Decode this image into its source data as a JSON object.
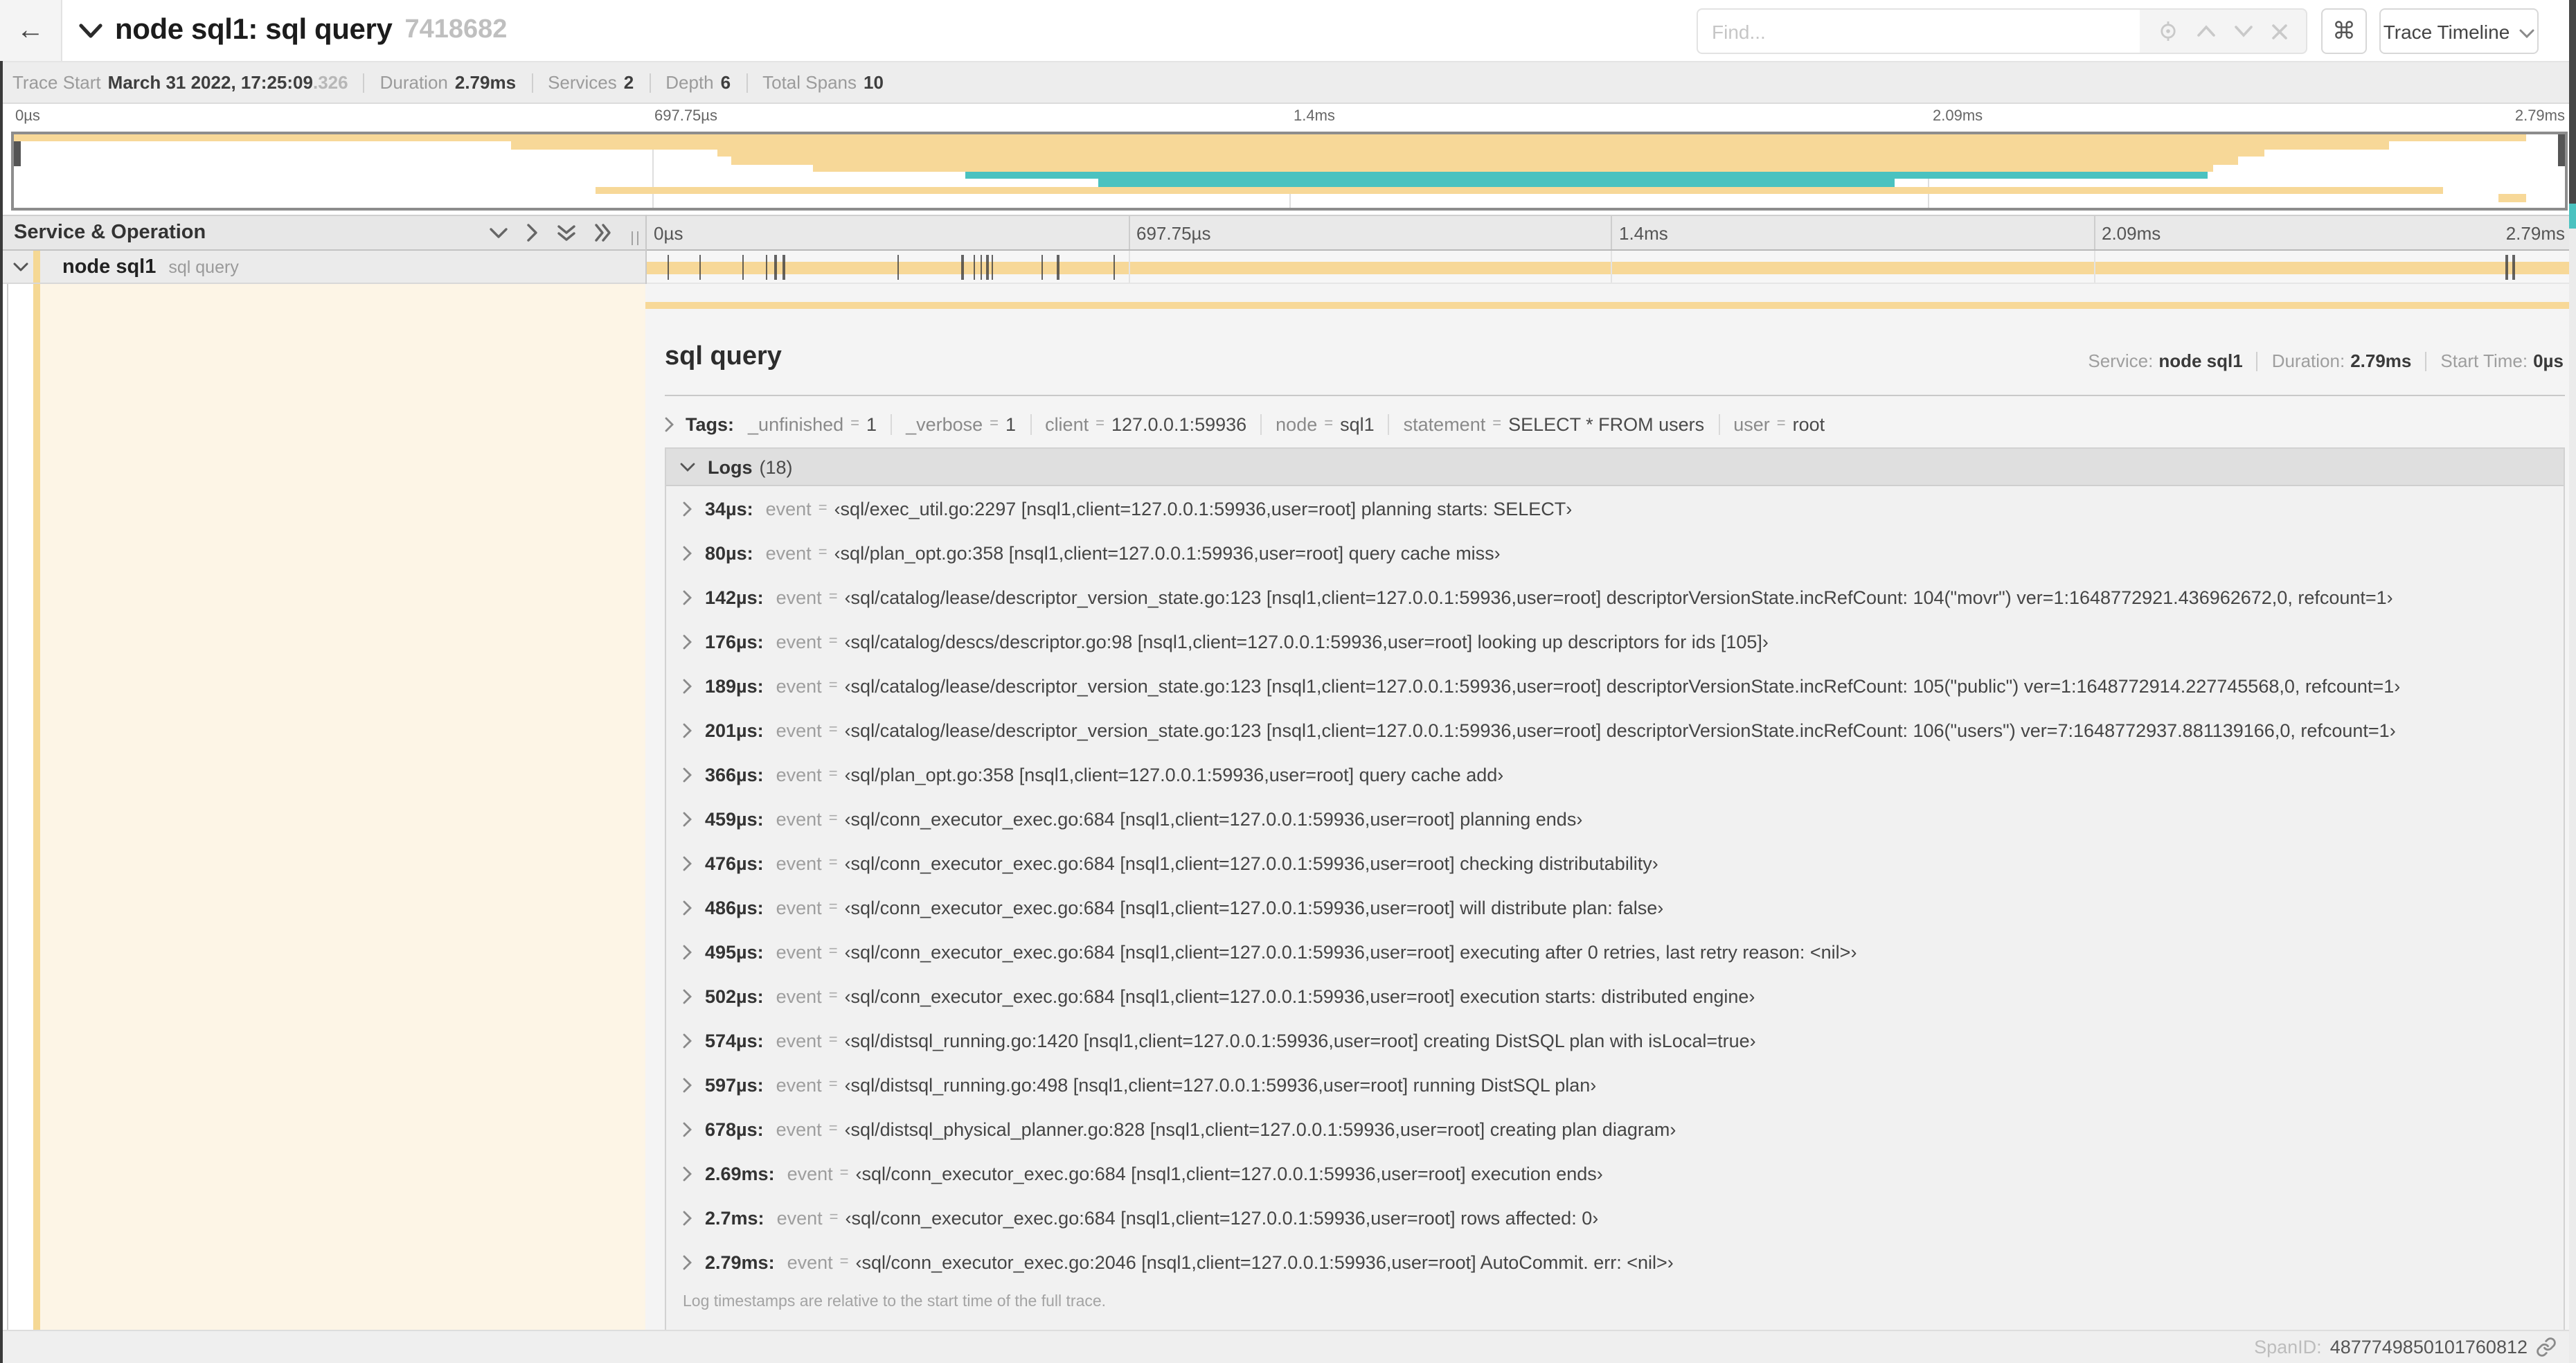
{
  "header": {
    "title": "node sql1: sql query",
    "trace_id": "7418682",
    "find_placeholder": "Find...",
    "view_select": "Trace Timeline"
  },
  "icons": {
    "back": "←",
    "command": "⌘"
  },
  "trace_info": {
    "items": [
      {
        "label": "Trace Start",
        "value": "March 31 2022, 17:25:09",
        "muted": ".326"
      },
      {
        "label": "Duration",
        "value": "2.79ms"
      },
      {
        "label": "Services",
        "value": "2"
      },
      {
        "label": "Depth",
        "value": "6"
      },
      {
        "label": "Total Spans",
        "value": "10"
      }
    ]
  },
  "colors": {
    "tan": "#f7d898",
    "teal": "#4ac2c0",
    "cream": "#fdf5e6",
    "strip": "#f5d894"
  },
  "minimap": {
    "ticks": [
      "0µs",
      "697.75µs",
      "1.4ms",
      "2.09ms",
      "2.79ms"
    ],
    "spans": [
      {
        "row": 0,
        "start": 0,
        "end": 98.5,
        "color": "tan"
      },
      {
        "row": 1,
        "start": 19.5,
        "end": 93.1,
        "color": "tan"
      },
      {
        "row": 2,
        "start": 27.6,
        "end": 88.2,
        "color": "tan"
      },
      {
        "row": 3,
        "start": 28.1,
        "end": 87.2,
        "color": "tan"
      },
      {
        "row": 4,
        "start": 31.3,
        "end": 86.2,
        "color": "tan"
      },
      {
        "row": 5,
        "start": 37.3,
        "end": 86.0,
        "color": "teal"
      },
      {
        "row": 6,
        "start": 42.5,
        "end": 73.7,
        "color": "teal"
      },
      {
        "row": 7,
        "start": 22.8,
        "end": 95.2,
        "color": "tan"
      },
      {
        "row": 8,
        "start": 97.4,
        "end": 98.5,
        "color": "tan"
      }
    ]
  },
  "timeline": {
    "header_title": "Service & Operation",
    "ruler_ticks": [
      "0µs",
      "697.75µs",
      "1.4ms",
      "2.09ms",
      "2.79ms"
    ],
    "row": {
      "service": "node sql1",
      "operation": "sql query",
      "total_us": 2790,
      "event_times_us": [
        34,
        80,
        142,
        176,
        189,
        201,
        366,
        459,
        476,
        486,
        495,
        502,
        574,
        597,
        678,
        2690,
        2700,
        2790
      ]
    }
  },
  "detail": {
    "operation": "sql query",
    "meta": [
      {
        "label": "Service:",
        "value": "node sql1"
      },
      {
        "label": "Duration:",
        "value": "2.79ms"
      },
      {
        "label": "Start Time:",
        "value": "0µs"
      }
    ],
    "tags": {
      "label": "Tags:",
      "separator": "=",
      "items": [
        {
          "key": "_unfinished",
          "value": "1"
        },
        {
          "key": "_verbose",
          "value": "1"
        },
        {
          "key": "client",
          "value": "127.0.0.1:59936"
        },
        {
          "key": "node",
          "value": "sql1"
        },
        {
          "key": "statement",
          "value": "SELECT * FROM users"
        },
        {
          "key": "user",
          "value": "root"
        }
      ]
    },
    "logs": {
      "label": "Logs",
      "count": "(18)",
      "field": "event",
      "separator": "=",
      "entries": [
        {
          "time": "34µs:",
          "value": "‹sql/exec_util.go:2297 [nsql1,client=127.0.0.1:59936,user=root] planning starts: SELECT›"
        },
        {
          "time": "80µs:",
          "value": "‹sql/plan_opt.go:358 [nsql1,client=127.0.0.1:59936,user=root] query cache miss›"
        },
        {
          "time": "142µs:",
          "value": "‹sql/catalog/lease/descriptor_version_state.go:123 [nsql1,client=127.0.0.1:59936,user=root] descriptorVersionState.incRefCount: 104(\"movr\") ver=1:1648772921.436962672,0, refcount=1›"
        },
        {
          "time": "176µs:",
          "value": "‹sql/catalog/descs/descriptor.go:98 [nsql1,client=127.0.0.1:59936,user=root] looking up descriptors for ids [105]›"
        },
        {
          "time": "189µs:",
          "value": "‹sql/catalog/lease/descriptor_version_state.go:123 [nsql1,client=127.0.0.1:59936,user=root] descriptorVersionState.incRefCount: 105(\"public\") ver=1:1648772914.227745568,0, refcount=1›"
        },
        {
          "time": "201µs:",
          "value": "‹sql/catalog/lease/descriptor_version_state.go:123 [nsql1,client=127.0.0.1:59936,user=root] descriptorVersionState.incRefCount: 106(\"users\") ver=7:1648772937.881139166,0, refcount=1›"
        },
        {
          "time": "366µs:",
          "value": "‹sql/plan_opt.go:358 [nsql1,client=127.0.0.1:59936,user=root] query cache add›"
        },
        {
          "time": "459µs:",
          "value": "‹sql/conn_executor_exec.go:684 [nsql1,client=127.0.0.1:59936,user=root] planning ends›"
        },
        {
          "time": "476µs:",
          "value": "‹sql/conn_executor_exec.go:684 [nsql1,client=127.0.0.1:59936,user=root] checking distributability›"
        },
        {
          "time": "486µs:",
          "value": "‹sql/conn_executor_exec.go:684 [nsql1,client=127.0.0.1:59936,user=root] will distribute plan: false›"
        },
        {
          "time": "495µs:",
          "value": "‹sql/conn_executor_exec.go:684 [nsql1,client=127.0.0.1:59936,user=root] executing after 0 retries, last retry reason: <nil>›"
        },
        {
          "time": "502µs:",
          "value": "‹sql/conn_executor_exec.go:684 [nsql1,client=127.0.0.1:59936,user=root] execution starts: distributed engine›"
        },
        {
          "time": "574µs:",
          "value": "‹sql/distsql_running.go:1420 [nsql1,client=127.0.0.1:59936,user=root] creating DistSQL plan with isLocal=true›"
        },
        {
          "time": "597µs:",
          "value": "‹sql/distsql_running.go:498 [nsql1,client=127.0.0.1:59936,user=root] running DistSQL plan›"
        },
        {
          "time": "678µs:",
          "value": "‹sql/distsql_physical_planner.go:828 [nsql1,client=127.0.0.1:59936,user=root] creating plan diagram›"
        },
        {
          "time": "2.69ms:",
          "value": "‹sql/conn_executor_exec.go:684 [nsql1,client=127.0.0.1:59936,user=root] execution ends›"
        },
        {
          "time": "2.7ms:",
          "value": "‹sql/conn_executor_exec.go:684 [nsql1,client=127.0.0.1:59936,user=root] rows affected: 0›"
        },
        {
          "time": "2.79ms:",
          "value": "‹sql/conn_executor_exec.go:2046 [nsql1,client=127.0.0.1:59936,user=root] AutoCommit. err: <nil>›"
        }
      ],
      "footnote": "Log timestamps are relative to the start time of the full trace."
    },
    "span_id_label": "SpanID:",
    "span_id": "4877749850101760812"
  }
}
